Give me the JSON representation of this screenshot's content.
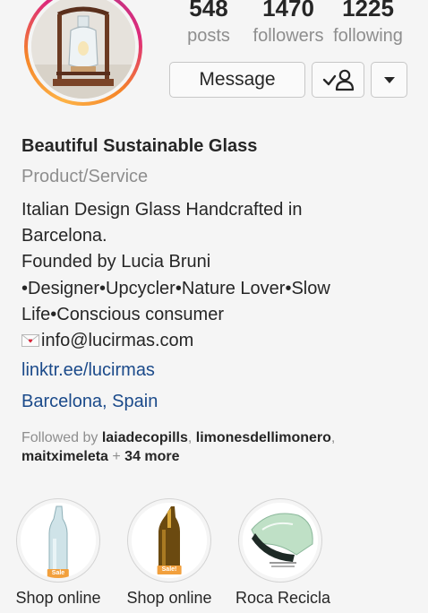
{
  "profile": {
    "stats": {
      "posts": {
        "count": "548",
        "label": "posts"
      },
      "followers": {
        "count": "1470",
        "label": "followers"
      },
      "following": {
        "count": "1225",
        "label": "following"
      }
    },
    "buttons": {
      "message": "Message"
    },
    "name": "Beautiful Sustainable Glass",
    "category": "Product/Service",
    "bio_lines": [
      "Italian Design Glass Handcrafted in",
      "Barcelona.",
      "Founded by Lucia Bruni",
      "•Designer•Upcycler•Nature Lover•Slow",
      "Life•Conscious consumer"
    ],
    "email": "info@lucirmas.com",
    "website": "linktr.ee/lucirmas",
    "location": "Barcelona, Spain",
    "followed_by": {
      "prefix": "Followed by ",
      "users": [
        "laiadecopills",
        "limonesdellimonero",
        "maitximeleta"
      ],
      "sep_comma": ", ",
      "plus": " + ",
      "more": "34 more"
    }
  },
  "highlights": [
    {
      "label": "Shop online",
      "badge": "Sale",
      "icon": "clear-glass-bottle"
    },
    {
      "label": "Shop online",
      "badge": "Sale!",
      "icon": "amber-glass-bottle"
    },
    {
      "label": "Roca Recicla",
      "icon": "green-glass-shard"
    }
  ],
  "colors": {
    "link": "#1b4a8a",
    "muted": "#8e8e8e",
    "text": "#262626",
    "sale_badge": "#f2a03d"
  }
}
